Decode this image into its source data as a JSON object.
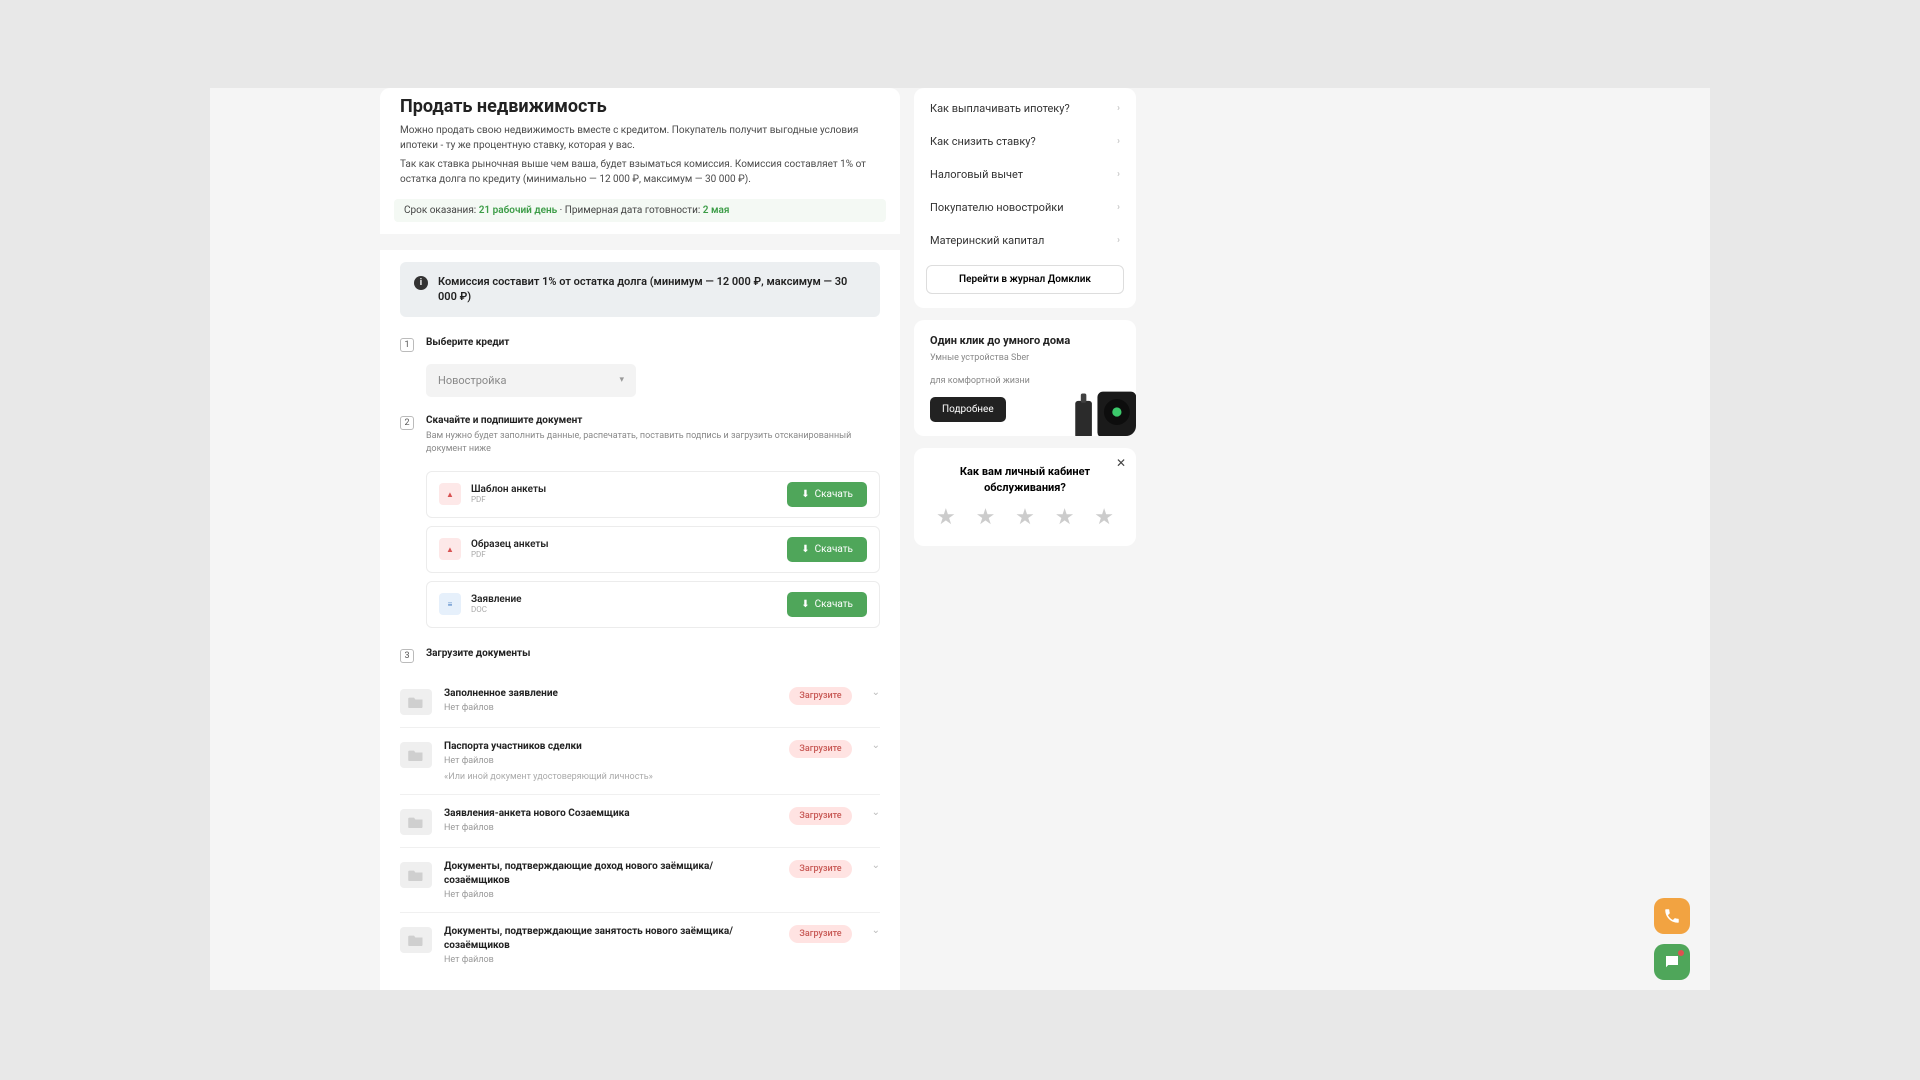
{
  "main": {
    "title": "Продать недвижимость",
    "desc1": "Можно продать свою недвижимость вместе с кредитом. Покупатель получит выгодные условия ипотеки - ту же процентную ставку, которая у вас.",
    "desc2": "Так как ставка рыночная выше чем ваша, будет взыматься комиссия. Комиссия составляет 1% от остатка долга по кредиту (минимально — 12 000 ₽, максимум — 30 000 ₽).",
    "deadline_prefix": "Срок оказания:",
    "deadline_days": "21 рабочий день",
    "deadline_mid": " · Примерная дата готовности: ",
    "deadline_date": "2 мая",
    "banner_text": "Комиссия составит 1% от остатка долга (минимум — 12 000 ₽, максимум — 30 000 ₽)"
  },
  "steps": {
    "s1": {
      "num": "1",
      "title": "Выберите кредит"
    },
    "s2": {
      "num": "2",
      "title": "Скачайте и подпишите документ",
      "hint": "Вам нужно будет заполнить данные, распечатать, поставить подпись и загрузить отсканированный документ ниже"
    },
    "s3": {
      "num": "3",
      "title": "Загрузите документы"
    }
  },
  "select": {
    "value": "Новостройка"
  },
  "download_label": "Скачать",
  "docs": {
    "d0": {
      "name": "Шаблон анкеты",
      "ext": "PDF",
      "type": "pdf"
    },
    "d1": {
      "name": "Образец анкеты",
      "ext": "PDF",
      "type": "pdf"
    },
    "d2": {
      "name": "Заявление",
      "ext": "DOC",
      "type": "doc"
    }
  },
  "no_files": "Нет файлов",
  "upload_badge": "Загрузите",
  "uploads": {
    "u0": {
      "title": "Заполненное заявление"
    },
    "u1": {
      "title": "Паспорта участников сделки",
      "hint": "«Или иной документ удостоверяющий личность»"
    },
    "u2": {
      "title": "Заявления-анкета нового Созаемщика"
    },
    "u3": {
      "title": "Документы, подтверждающие доход нового заёмщика/созаёмщиков"
    },
    "u4": {
      "title": "Документы, подтверждающие занятость нового заёмщика/созаёмщиков"
    }
  },
  "sidebar": {
    "items": {
      "i0": "Как выплачивать ипотеку?",
      "i1": "Как снизить ставку?",
      "i2": "Налоговый вычет",
      "i3": "Покупателю новостройки",
      "i4": "Материнский капитал"
    },
    "button": "Перейти в журнал Домклик"
  },
  "promo": {
    "title": "Один клик до умного дома",
    "sub1": "Умные устройства Sber",
    "sub2": "для комфортной жизни",
    "btn": "Подробнее"
  },
  "rating": {
    "title": "Как вам личный кабинет обслуживания?"
  }
}
